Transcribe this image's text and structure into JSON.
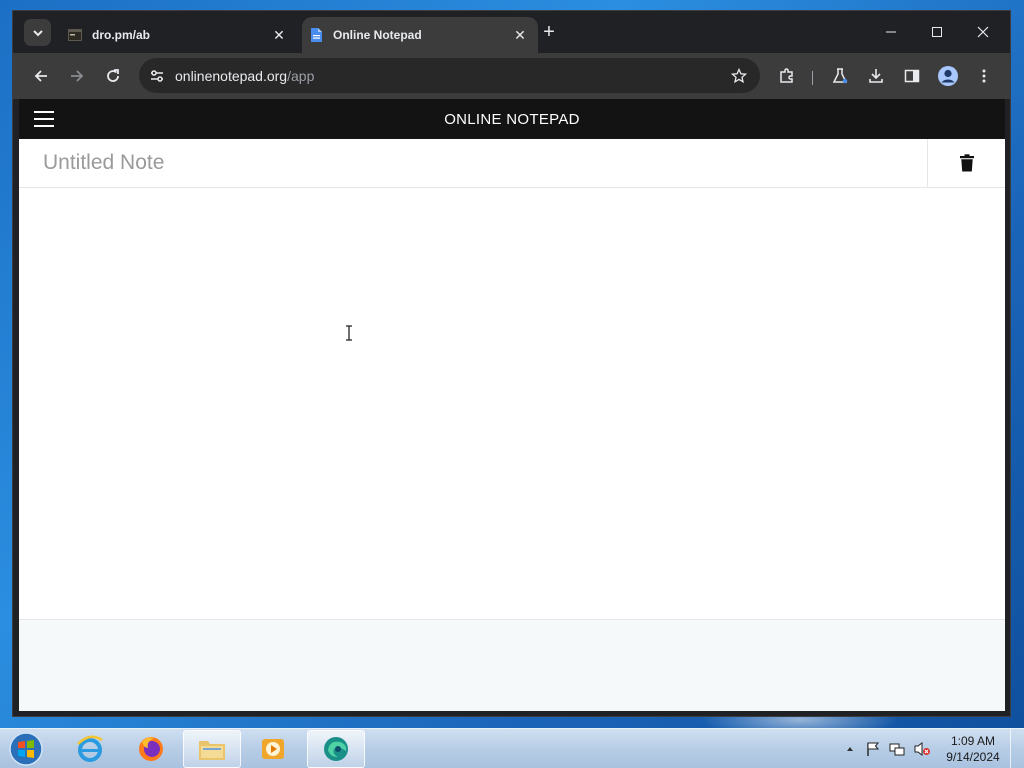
{
  "browser": {
    "tabs": [
      {
        "title": "dro.pm/ab",
        "active": false,
        "favicon": "terminal-favicon-icon"
      },
      {
        "title": "Online Notepad",
        "active": true,
        "favicon": "document-favicon-icon"
      }
    ],
    "close_symbol": "✕",
    "new_tab_symbol": "+",
    "address": {
      "domain": "onlinenotepad.org",
      "path": "/app"
    }
  },
  "app": {
    "header_title": "ONLINE NOTEPAD",
    "note_title_placeholder": "Untitled Note",
    "note_body": ""
  },
  "taskbar": {
    "time": "1:09 AM",
    "date": "9/14/2024"
  },
  "colors": {
    "header_bg": "#131313",
    "chrome_bg": "#202124",
    "toolbar_bg": "#3c3c3c",
    "footer_bg": "#f6f9fa"
  }
}
